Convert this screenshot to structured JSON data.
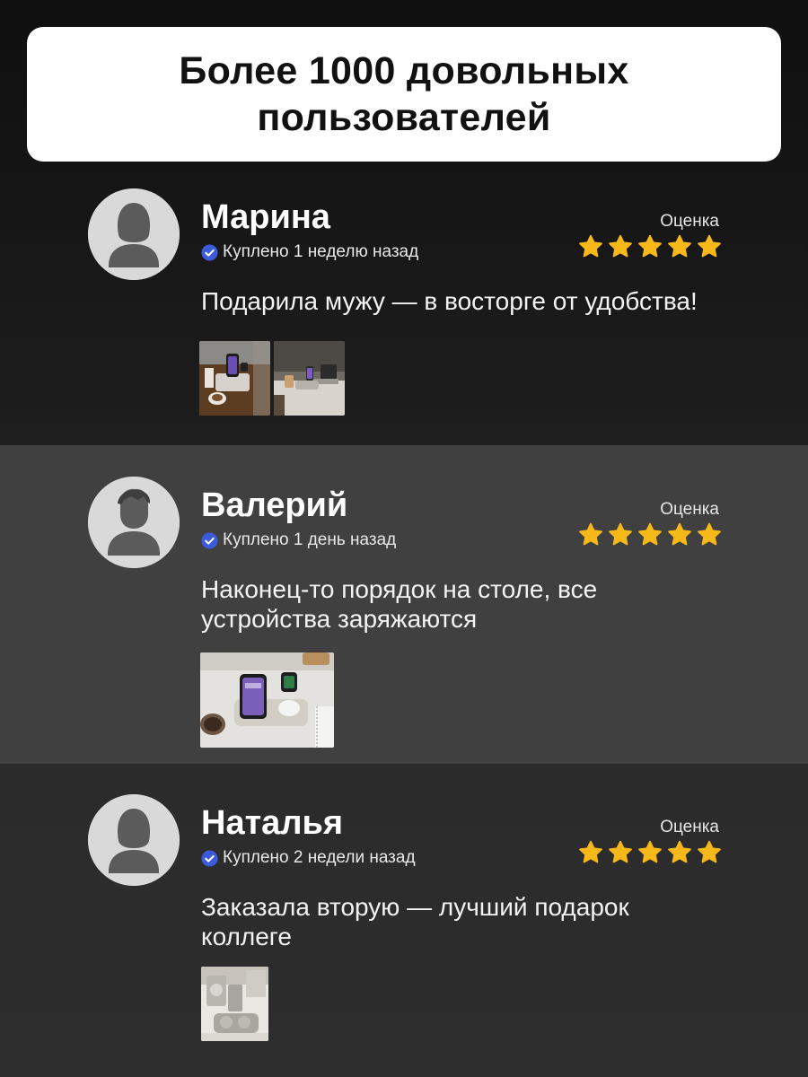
{
  "header": {
    "title": "Более 1000 довольных пользователей"
  },
  "reviews": [
    {
      "name": "Марина",
      "purchased": "Куплено 1 неделю назад",
      "rating_label": "Оценка",
      "stars": 5,
      "text": "Подарила мужу — в восторге от удобства!",
      "avatar": "female-avatar-icon",
      "photos": 2
    },
    {
      "name": "Валерий",
      "purchased": "Куплено 1 день назад",
      "rating_label": "Оценка",
      "stars": 5,
      "text": "Наконец-то порядок на столе, все устройства заряжаются",
      "avatar": "male-avatar-icon",
      "photos": 1
    },
    {
      "name": "Наталья",
      "purchased": "Куплено 2 недели назад",
      "rating_label": "Оценка",
      "stars": 5,
      "text": "Заказала вторую — лучший подарок коллеге",
      "avatar": "female-avatar-icon",
      "photos": 1
    }
  ],
  "colors": {
    "star": "#f7b81a",
    "verified": "#3b5bdb",
    "header_bg": "#ffffff"
  }
}
